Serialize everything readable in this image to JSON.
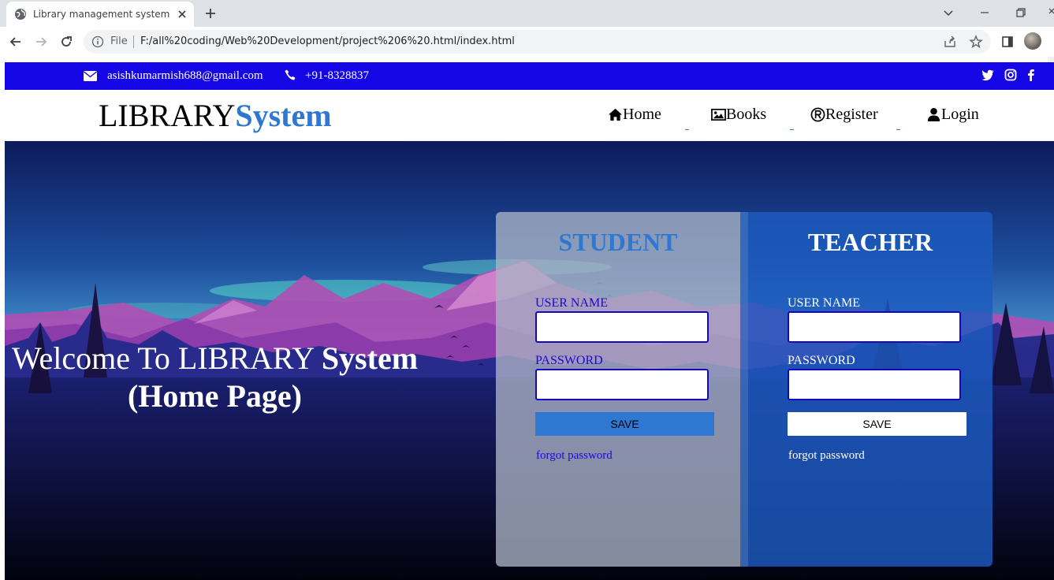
{
  "browser": {
    "tab_title": "Library management system",
    "file_label": "File",
    "url": "F:/all%20coding/Web%20Development/project%206%20.html/index.html"
  },
  "topbar": {
    "email": "asishkumarmish688@gmail.com",
    "phone": "+91-8328837",
    "social_icons": [
      "twitter-icon",
      "instagram-icon",
      "facebook-icon"
    ]
  },
  "header": {
    "brand_part1": "LIBRARY",
    "brand_part2": "System",
    "nav": [
      {
        "label": "Home",
        "icon": "home-icon"
      },
      {
        "label": "Books",
        "icon": "image-icon"
      },
      {
        "label": "Register",
        "icon": "registered-icon"
      },
      {
        "label": "Login",
        "icon": "user-icon"
      }
    ]
  },
  "hero": {
    "welcome_line1_normal": "Welcome To LIBRARY ",
    "welcome_line1_bold": "System",
    "welcome_line2": "(Home Page)"
  },
  "student": {
    "title": "STUDENT",
    "username_label": "USER NAME",
    "password_label": "PASSWORD",
    "save_label": "SAVE",
    "forgot_label": "forgot password"
  },
  "teacher": {
    "title": "TEACHER",
    "username_label": "USER NAME",
    "password_label": "PASSWORD",
    "save_label": "SAVE",
    "forgot_label": "forgot password"
  },
  "colors": {
    "topbar": "#1506e6",
    "accent": "#2e78d2"
  }
}
